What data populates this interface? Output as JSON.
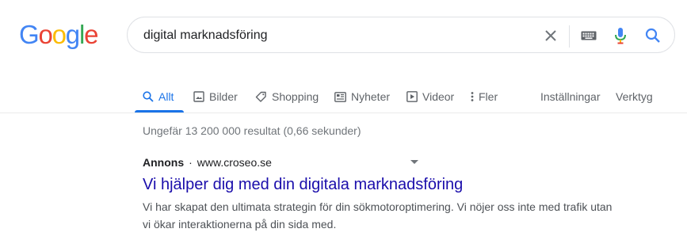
{
  "logo": {
    "letters": [
      "G",
      "o",
      "o",
      "g",
      "l",
      "e"
    ],
    "colors": [
      "#4285F4",
      "#EA4335",
      "#FBBC05",
      "#4285F4",
      "#34A853",
      "#EA4335"
    ]
  },
  "search": {
    "query": "digital marknadsföring"
  },
  "icons": {
    "clear": "close-icon",
    "keyboard": "keyboard-icon",
    "mic": "mic-icon",
    "search": "search-icon"
  },
  "tabs": [
    {
      "label": "Allt",
      "icon": "search-icon",
      "active": true
    },
    {
      "label": "Bilder",
      "icon": "image-icon",
      "active": false
    },
    {
      "label": "Shopping",
      "icon": "tag-icon",
      "active": false
    },
    {
      "label": "Nyheter",
      "icon": "news-icon",
      "active": false
    },
    {
      "label": "Videor",
      "icon": "video-icon",
      "active": false
    },
    {
      "label": "Fler",
      "icon": "more-vert-icon",
      "active": false
    }
  ],
  "tools": {
    "settings": "Inställningar",
    "tools": "Verktyg"
  },
  "results": {
    "stats": "Ungefär 13 200 000 resultat (0,66 sekunder)"
  },
  "ad": {
    "label": "Annons",
    "separator": "·",
    "url": "www.croseo.se",
    "title": "Vi hjälper dig med din digitala marknadsföring",
    "description": "Vi har skapat den ultimata strategin för din sökmotoroptimering. Vi nöjer oss inte med trafik utan vi ökar interaktionerna på din sida med."
  },
  "colors": {
    "accent": "#1a73e8",
    "link": "#1a0dab",
    "muted": "#70757a",
    "snippet": "#4d5156"
  }
}
